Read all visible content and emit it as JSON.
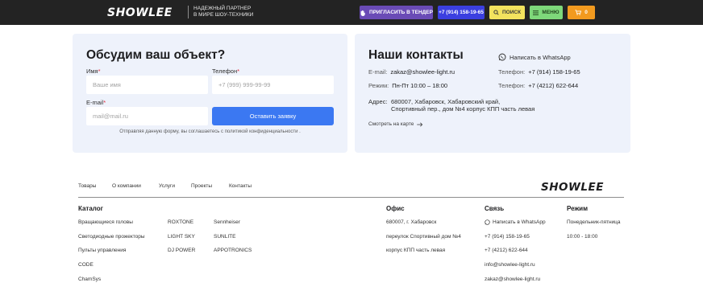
{
  "header": {
    "logo": "SHOWLEE",
    "tagline": [
      "НАДЕЖНЫЙ ПАРТНЕР",
      "В МИРЕ ШОУ-ТЕХНИКИ"
    ],
    "tender_label": "ПРИГЛАСИТЬ В ТЕНДЕР",
    "phone_label": "+7 (914) 158-19-65",
    "search_label": "ПОИСК",
    "menu_label": "МЕНЮ",
    "cart_count": "0",
    "colors": {
      "tender": "#6a4bb6",
      "phone": "#3b3fe0",
      "search": "#f3e35e",
      "menu": "#7ed87a",
      "cart": "#f29a1f"
    }
  },
  "form": {
    "title": "Обсудим ваш объект?",
    "name_label": "Имя",
    "name_placeholder": "Ваше имя",
    "phone_label": "Телефон",
    "phone_placeholder": "+7 (999) 999-99-99",
    "email_label": "E-mail",
    "email_placeholder": "mail@mail.ru",
    "required_mark": "*",
    "submit_label": "Оставить заявку",
    "consent": "Отправляя данную форму, вы соглашаетесь с политикой конфиденциальности ."
  },
  "contacts": {
    "title": "Наши контакты",
    "whatsapp_label": "Написать в WhatsApp",
    "email_key": "E-mail:",
    "email_value": "zakaz@showlee-light.ru",
    "hours_key": "Режим:",
    "hours_value": "Пн-Пт 10:00 – 18:00",
    "address_key": "Адрес:",
    "address_line1": "680007, Хабаровск, Хабаровский край,",
    "address_line2": "Спортивный пер., дом №4 корпус КПП часть левая",
    "phone1_key": "Телефон:",
    "phone1_value": "+7 (914) 158-19-65",
    "phone2_key": "Телефон:",
    "phone2_value": "+7 (4212) 622-644",
    "map_label": "Смотреть на карте"
  },
  "footer": {
    "nav": [
      "Товары",
      "О компании",
      "Услуги",
      "Проекты",
      "Контакты"
    ],
    "logo": "SHOWLEE",
    "catalog": {
      "title": "Каталог",
      "col1": [
        "Вращающиеся головы",
        "Светодиодные прожекторы",
        "Пульты управления",
        "CODE",
        "ChamSys"
      ],
      "col2": [
        "ROXTONE",
        "LIGHT SKY",
        "DJ POWER"
      ],
      "col3": [
        "Sennheiser",
        "SUNLITE",
        "APPOTRONICS"
      ]
    },
    "office": {
      "title": "Офис",
      "lines": [
        "680007, г. Хабаровск",
        "переулок Спортивный дом №4",
        "корпус КПП часть левая"
      ]
    },
    "contact": {
      "title": "Связь",
      "whatsapp": "Написать в WhatsApp",
      "phone1": "+7 (914) 158-19-65",
      "phone2": "+7 (4212) 622-644",
      "email1": "info@showlee-light.ru",
      "email2": "zakaz@showlee-light.ru"
    },
    "schedule": {
      "title": "Режим",
      "days": "Понедельник-пятница",
      "hours": "10:00 - 18:00"
    }
  }
}
